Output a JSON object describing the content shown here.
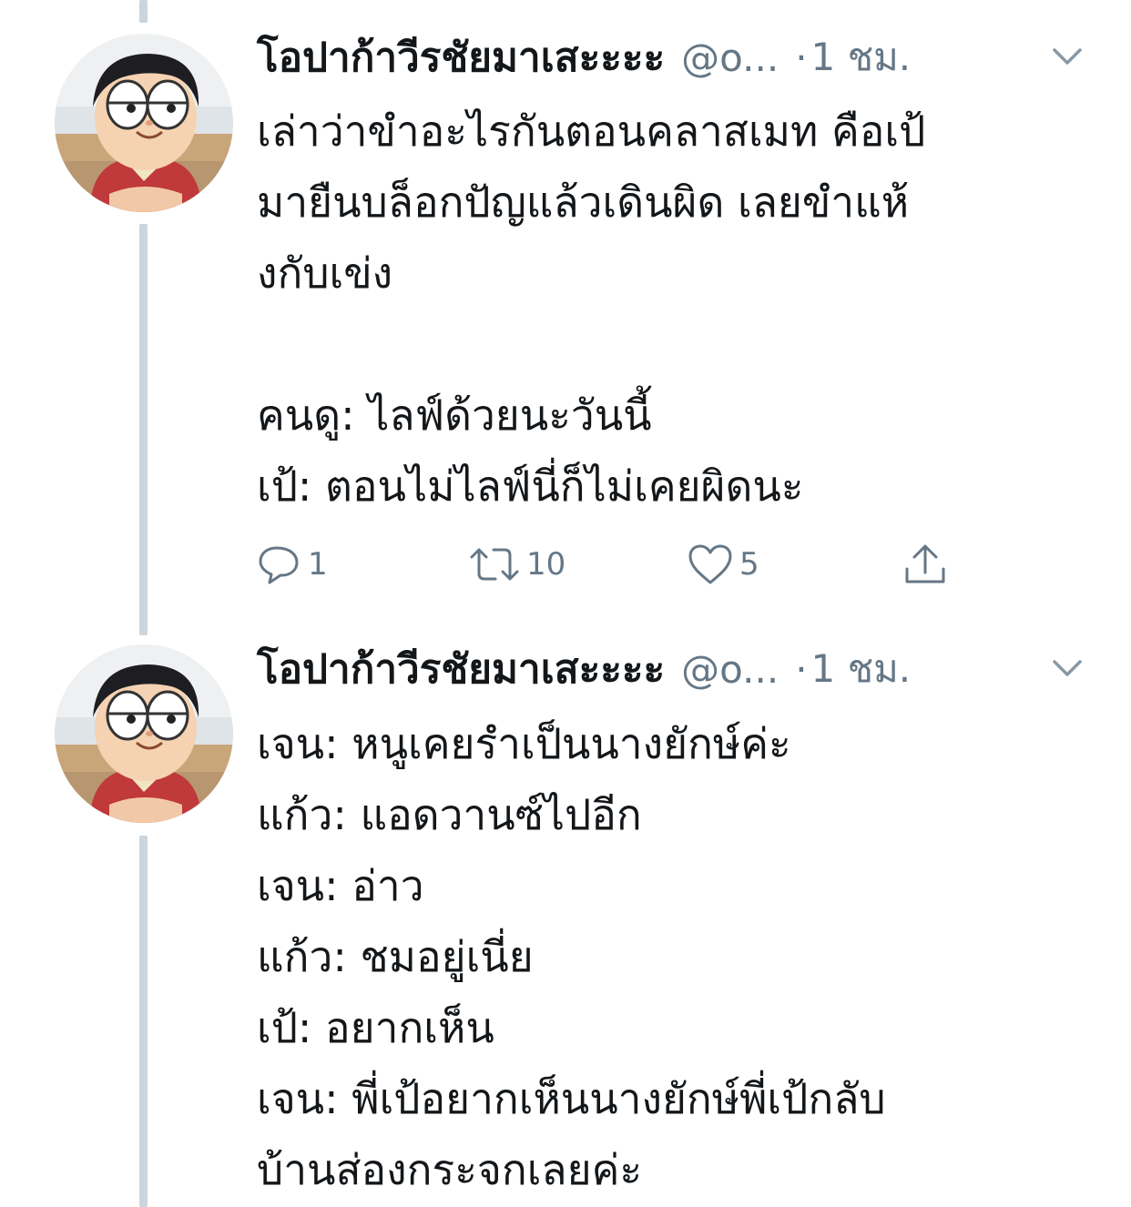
{
  "tweets": [
    {
      "display_name": "โอปาก้าวีรชัยมาเสะะะะ",
      "handle": "@o...",
      "separator": "·",
      "time": "1 ชม.",
      "lines": [
        "เล่าว่าขำอะไรกันตอนคลาสเมท คือเป้",
        "มายืนบล็อกปัญแล้วเดินผิด เลยขำแห้",
        "งกับเข่ง",
        "",
        "คนดู: ไลฟ์ด้วยนะวันนี้",
        "เป้: ตอนไม่ไลฟ์นี่ก็ไม่เคยผิดนะ"
      ],
      "actions": {
        "reply_icon": "reply-icon",
        "reply_count": "1",
        "retweet_icon": "retweet-icon",
        "retweet_count": "10",
        "like_icon": "heart-icon",
        "like_count": "5",
        "share_icon": "share-icon"
      }
    },
    {
      "display_name": "โอปาก้าวีรชัยมาเสะะะะ",
      "handle": "@o...",
      "separator": "·",
      "time": "1 ชม.",
      "lines": [
        "เจน: หนูเคยรำเป็นนางยักษ์ค่ะ",
        "แก้ว: แอดวานซ์ไปอีก",
        "เจน: อ่าว",
        "แก้ว: ชมอยู่เนี่ย",
        "เป้: อยากเห็น",
        "เจน: พี่เป้อยากเห็นนางยักษ์พี่เป้กลับ",
        "บ้านส่องกระจกเลยค่ะ"
      ]
    }
  ],
  "colors": {
    "text": "#14171a",
    "secondary": "#657786",
    "thread_line": "#cbd5dd"
  }
}
